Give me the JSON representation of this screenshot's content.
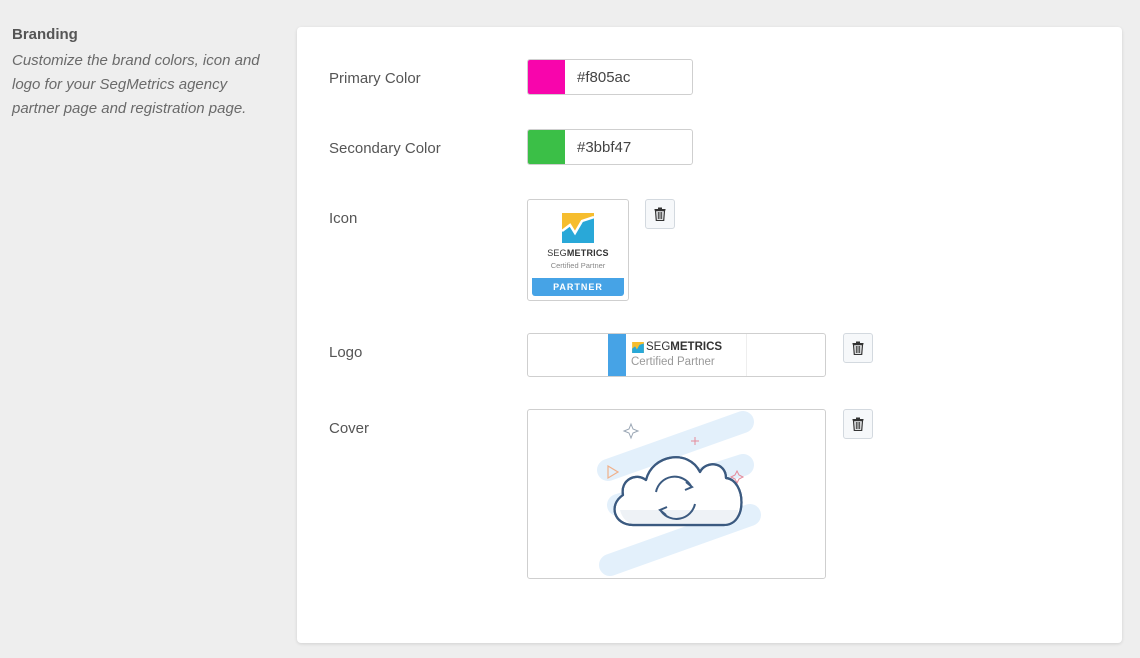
{
  "section": {
    "title": "Branding",
    "description": "Customize the brand colors, icon and logo for your SegMetrics agency partner page and registration page."
  },
  "fields": {
    "primary": {
      "label": "Primary Color",
      "value": "#f805ac",
      "color": "#f805ac"
    },
    "secondary": {
      "label": "Secondary Color",
      "value": "#3bbf47",
      "color": "#3bbf47"
    },
    "icon": {
      "label": "Icon"
    },
    "logo": {
      "label": "Logo"
    },
    "cover": {
      "label": "Cover"
    }
  },
  "icon_badge": {
    "brand_light": "SEG",
    "brand_bold": "METRICS",
    "subtitle": "Certified Partner",
    "ribbon": "PARTNER"
  },
  "logo_image": {
    "brand_light": "SEG",
    "brand_bold": "METRICS",
    "subtitle": "Certified Partner"
  },
  "colors": {
    "partner_blue": "#46a3e6",
    "cover_line": "#3b5a80",
    "cover_bg": "#e3f0fb"
  },
  "icons": {
    "delete": "trash-icon",
    "cover_placeholder": "cloud-sync-icon"
  }
}
